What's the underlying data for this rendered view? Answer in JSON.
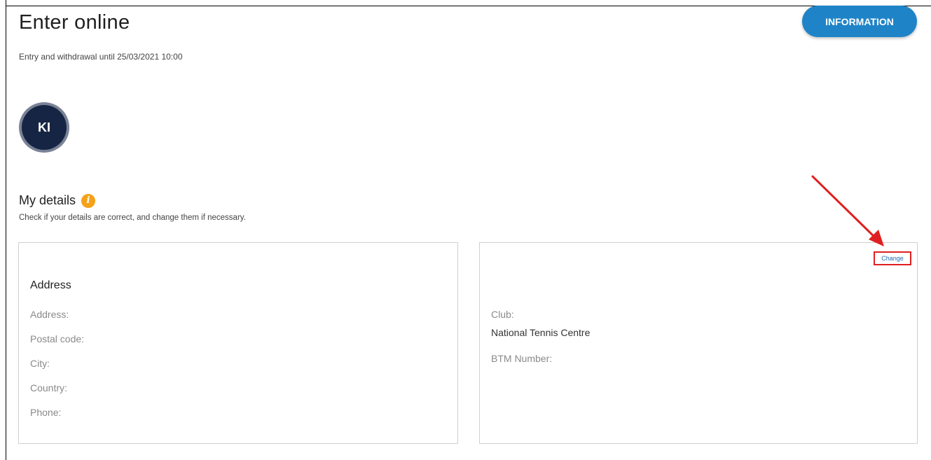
{
  "header": {
    "title": "Enter online",
    "subtitle": "Entry and withdrawal until 25/03/2021 10:00",
    "info_button": "INFORMATION"
  },
  "avatar": {
    "initials": "KI"
  },
  "details": {
    "title": "My details",
    "description": "Check if your details are correct, and change them if necessary."
  },
  "address_card": {
    "heading": "Address",
    "fields": [
      "Address:",
      "Postal code:",
      "City:",
      "Country:",
      "Phone:"
    ]
  },
  "club_card": {
    "change_label": "Change",
    "club_label": "Club:",
    "club_value": "National Tennis Centre",
    "btm_label": "BTM Number:"
  },
  "colors": {
    "accent": "#1f84c7",
    "avatar_bg": "#172545",
    "info_icon": "#f4a21a",
    "annotation_red": "#e02020"
  },
  "icons": {
    "info": "info-icon",
    "annotation": "red-arrow"
  }
}
